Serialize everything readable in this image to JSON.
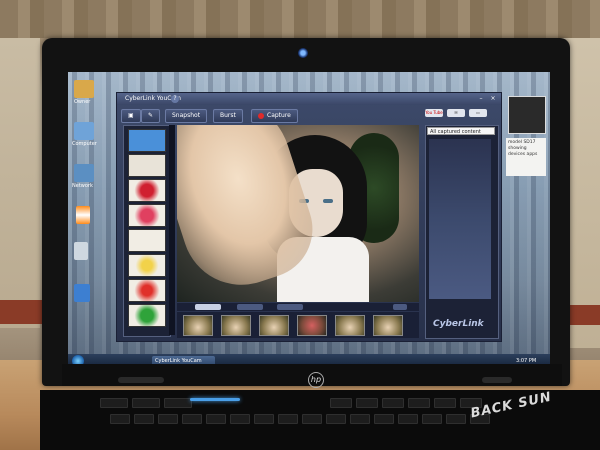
{
  "window": {
    "title": "CyberLink YouCam",
    "toolbar": {
      "snapshot_label": "Snapshot",
      "burst_label": "Burst",
      "capture_label": "Capture"
    },
    "controls": {
      "minimize": "–",
      "close": "×",
      "help": "?"
    }
  },
  "right_panel": {
    "filter_value": "All captured content",
    "brand": "CyberLink",
    "youtube_label": "You Tube"
  },
  "desktop": {
    "icons": [
      "Owner",
      "Computer",
      "Network"
    ]
  },
  "taskbar": {
    "task_label": "CyberLink YouCam",
    "clock": "3:07 PM"
  },
  "gadget_note": "model SD17 showing devices apps",
  "laptop": {
    "brand_logo": "hp"
  },
  "watermark": "BACK SUN",
  "colors": {
    "accent": "#4a90d9",
    "record": "#e02a2a",
    "webcam_light": "#7fb8ff"
  }
}
